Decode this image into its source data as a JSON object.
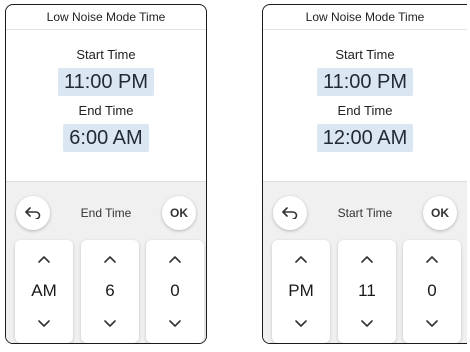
{
  "screens": [
    {
      "header_title": "Low Noise Mode Time",
      "start_label": "Start Time",
      "start_value": "11:00 PM",
      "end_label": "End Time",
      "end_value": "6:00 AM",
      "picker": {
        "title": "End Time",
        "ok_label": "OK",
        "columns": [
          {
            "value": "AM"
          },
          {
            "value": "6"
          },
          {
            "value": "0"
          }
        ]
      }
    },
    {
      "header_title": "Low Noise Mode Time",
      "start_label": "Start Time",
      "start_value": "11:00 PM",
      "end_label": "End Time",
      "end_value": "12:00 AM",
      "picker": {
        "title": "Start Time",
        "ok_label": "OK",
        "columns": [
          {
            "value": "PM"
          },
          {
            "value": "11"
          },
          {
            "value": "0"
          }
        ]
      }
    }
  ],
  "icons": {
    "back": "back-arrow-icon",
    "up": "chevron-up-icon",
    "down": "chevron-down-icon"
  },
  "colors": {
    "time_highlight": "#dbe6f3",
    "sheet_background": "#f0f0f0"
  }
}
